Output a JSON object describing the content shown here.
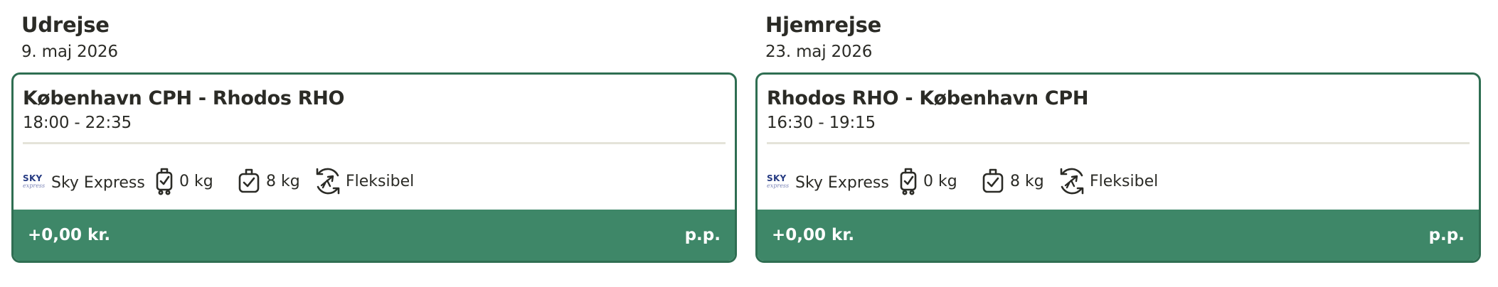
{
  "outbound": {
    "heading": "Udrejse",
    "date": "9. maj 2026",
    "route": "København CPH - Rhodos RHO",
    "times": "18:00 - 22:35",
    "airline_logo_top": "SKY",
    "airline_logo_bottom": "express",
    "airline": "Sky Express",
    "hand_luggage": "0 kg",
    "checked_luggage": "8 kg",
    "flex": "Fleksibel",
    "price": "+0,00 kr.",
    "per_person": "p.p."
  },
  "return": {
    "heading": "Hjemrejse",
    "date": "23. maj 2026",
    "route": "Rhodos RHO - København CPH",
    "times": "16:30 - 19:15",
    "airline_logo_top": "SKY",
    "airline_logo_bottom": "express",
    "airline": "Sky Express",
    "hand_luggage": "0 kg",
    "checked_luggage": "8 kg",
    "flex": "Fleksibel",
    "price": "+0,00 kr.",
    "per_person": "p.p."
  },
  "icons": {
    "hand_luggage": "carry-on-bag-check-icon",
    "checked_luggage": "checked-bag-check-icon",
    "flex": "flexible-flight-icon"
  },
  "colors": {
    "accent": "#3e8768",
    "border": "#2f6e52",
    "divider": "#e4e3d9",
    "text": "#2b2b26",
    "airline_logo": "#263b82"
  }
}
